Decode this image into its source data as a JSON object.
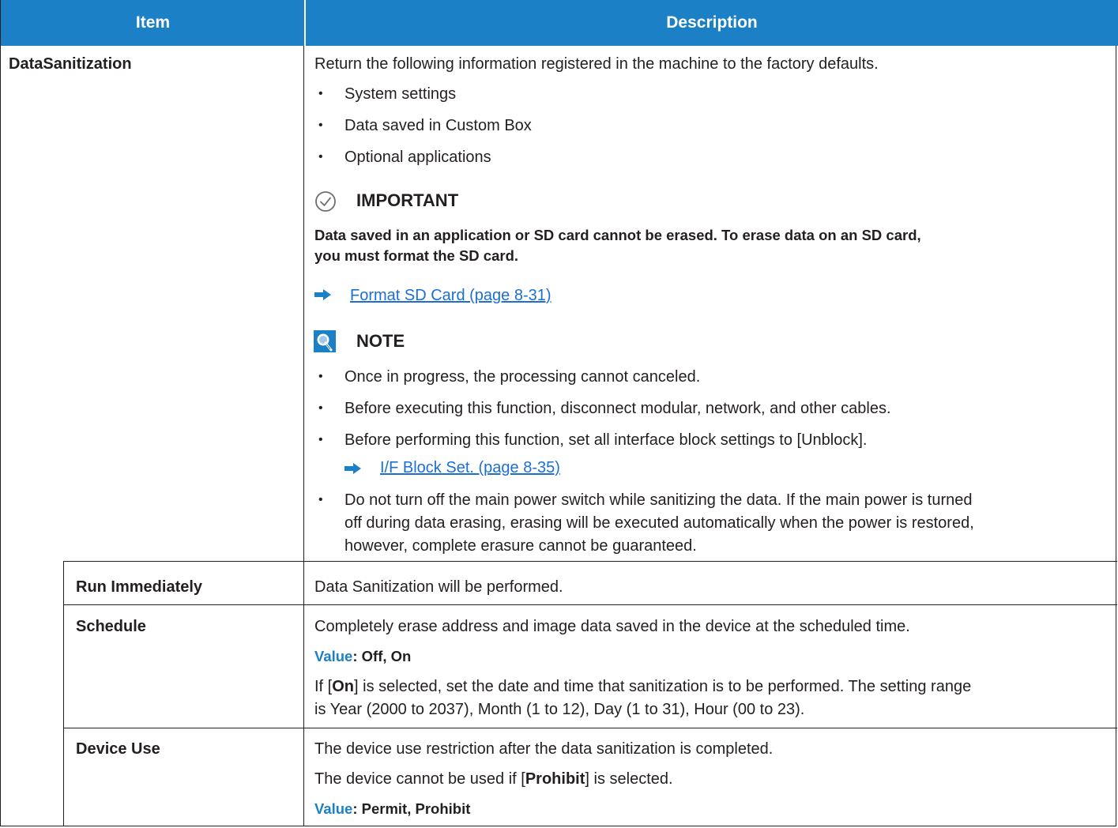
{
  "header": {
    "item": "Item",
    "description": "Description"
  },
  "rows": {
    "datasanitization": {
      "item": "DataSanitization",
      "intro": "Return the following information registered in the machine to the factory defaults.",
      "bullets": [
        "System settings",
        "Data saved in Custom Box",
        "Optional applications"
      ],
      "important": {
        "title": "IMPORTANT",
        "line1": "Data saved in an application or SD card cannot be erased. To erase data on an SD card,",
        "line2": "you must format the SD card.",
        "link": "Format SD Card (page 8-31)"
      },
      "note": {
        "title": "NOTE",
        "b1": "Once in progress, the processing cannot canceled.",
        "b2": "Before executing this function, disconnect modular, network, and other cables.",
        "b3": "Before performing this function, set all interface block settings to [Unblock].",
        "b3_link": "I/F Block Set. (page 8-35)",
        "b4_l1": "Do not turn off the main power switch while sanitizing the data. If the main power is turned",
        "b4_l2": "off during data erasing, erasing will be executed automatically when the power is restored,",
        "b4_l3": "however, complete erasure cannot be guaranteed."
      }
    },
    "run": {
      "item": "Run Immediately",
      "desc": "Data Sanitization will be performed."
    },
    "schedule": {
      "item": "Schedule",
      "desc": "Completely erase address and image data saved in the device at the scheduled time.",
      "value_label": "Value",
      "value": ": Off, On",
      "l3_pre": "If [",
      "l3_bold": "On",
      "l3_post": "] is selected, set the date and time that sanitization is to be performed. The setting range",
      "l4": "is Year (2000 to 2037), Month (1 to 12), Day (1 to 31), Hour (00 to 23)."
    },
    "device_use": {
      "item": "Device Use",
      "desc": "The device use restriction after the data sanitization is completed.",
      "l2_pre": "The device cannot be used if [",
      "l2_bold": "Prohibit",
      "l2_post": "] is selected.",
      "value_label": "Value",
      "value": ": Permit, Prohibit"
    }
  },
  "colors": {
    "header_bg": "#1c80c7",
    "link": "#1c6fd1",
    "value_label": "#1c80c7"
  },
  "icons": {
    "important": "check-circle-icon",
    "note": "lightbulb-icon",
    "link_arrow": "right-arrow-icon"
  }
}
